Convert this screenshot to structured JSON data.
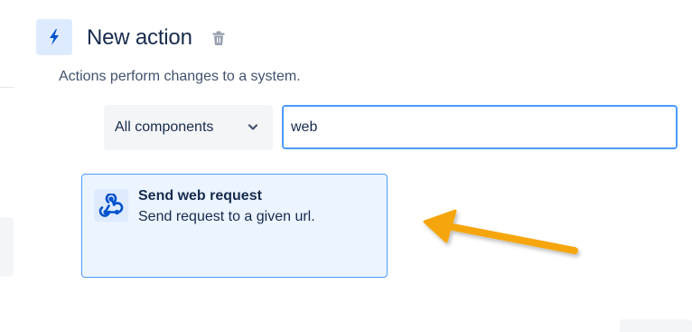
{
  "header": {
    "title": "New action",
    "icon": "lightning-bolt-icon",
    "delete_icon": "trash-icon"
  },
  "subtitle": "Actions perform changes to a system.",
  "filter": {
    "component_select": {
      "selected": "All components",
      "icon": "chevron-down-icon"
    },
    "search": {
      "value": "web"
    }
  },
  "results": [
    {
      "title": "Send web request",
      "description": "Send request to a given url.",
      "icon": "webhook-icon"
    }
  ],
  "annotation": {
    "icon": "arrow-pointer-icon",
    "color": "#f6a609"
  },
  "colors": {
    "accent": "#0052cc",
    "focus_border": "#4c9aff",
    "card_bg": "#ebf4ff",
    "icon_bg": "#deebff",
    "text": "#172b4d"
  }
}
